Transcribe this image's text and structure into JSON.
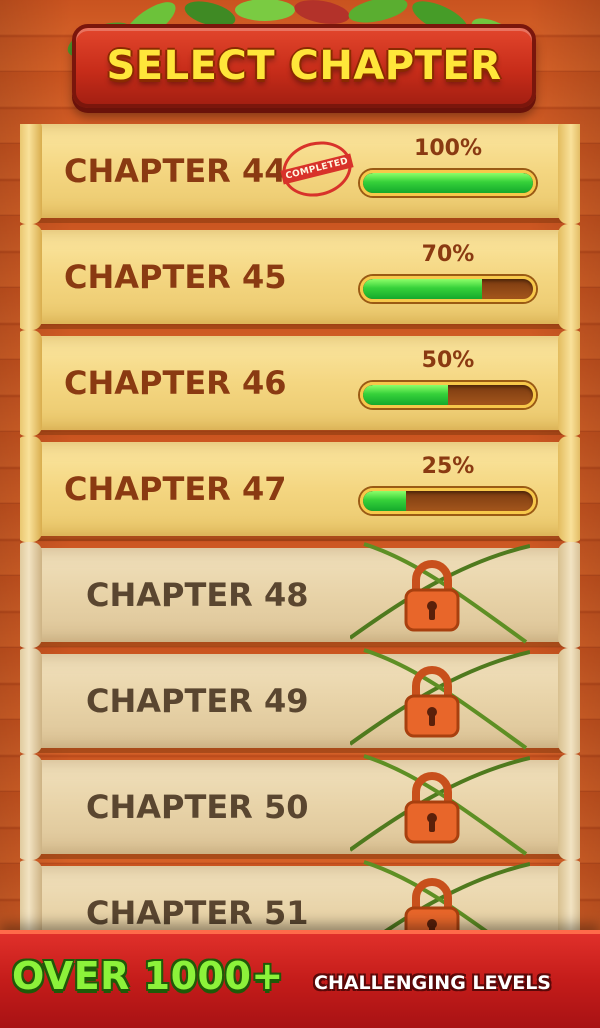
{
  "header": {
    "title": "SELECT CHAPTER"
  },
  "chapters": [
    {
      "label": "CHAPTER 44",
      "locked": false,
      "progress_percent": 100,
      "progress_label": "100%",
      "stamp": "COMPLETED"
    },
    {
      "label": "CHAPTER 45",
      "locked": false,
      "progress_percent": 70,
      "progress_label": "70%"
    },
    {
      "label": "CHAPTER 46",
      "locked": false,
      "progress_percent": 50,
      "progress_label": "50%"
    },
    {
      "label": "CHAPTER 47",
      "locked": false,
      "progress_percent": 25,
      "progress_label": "25%"
    },
    {
      "label": "CHAPTER 48",
      "locked": true
    },
    {
      "label": "CHAPTER 49",
      "locked": true
    },
    {
      "label": "CHAPTER 50",
      "locked": true
    },
    {
      "label": "CHAPTER 51",
      "locked": true
    }
  ],
  "footer": {
    "headline": "OVER 1000+",
    "subline": "CHALLENGING LEVELS"
  },
  "icons": {
    "lock": "padlock-icon",
    "vines": "vine-icon",
    "leaves": "leaves-icon"
  },
  "colors": {
    "title_text": "#ffe63a",
    "title_board": "#c82d1a",
    "progress_fill": "#36d13a",
    "progress_track": "#8a4414",
    "padlock": "#e8662a",
    "footer_headline": "#8cf23a",
    "footer_bg": "#c41c1a"
  }
}
